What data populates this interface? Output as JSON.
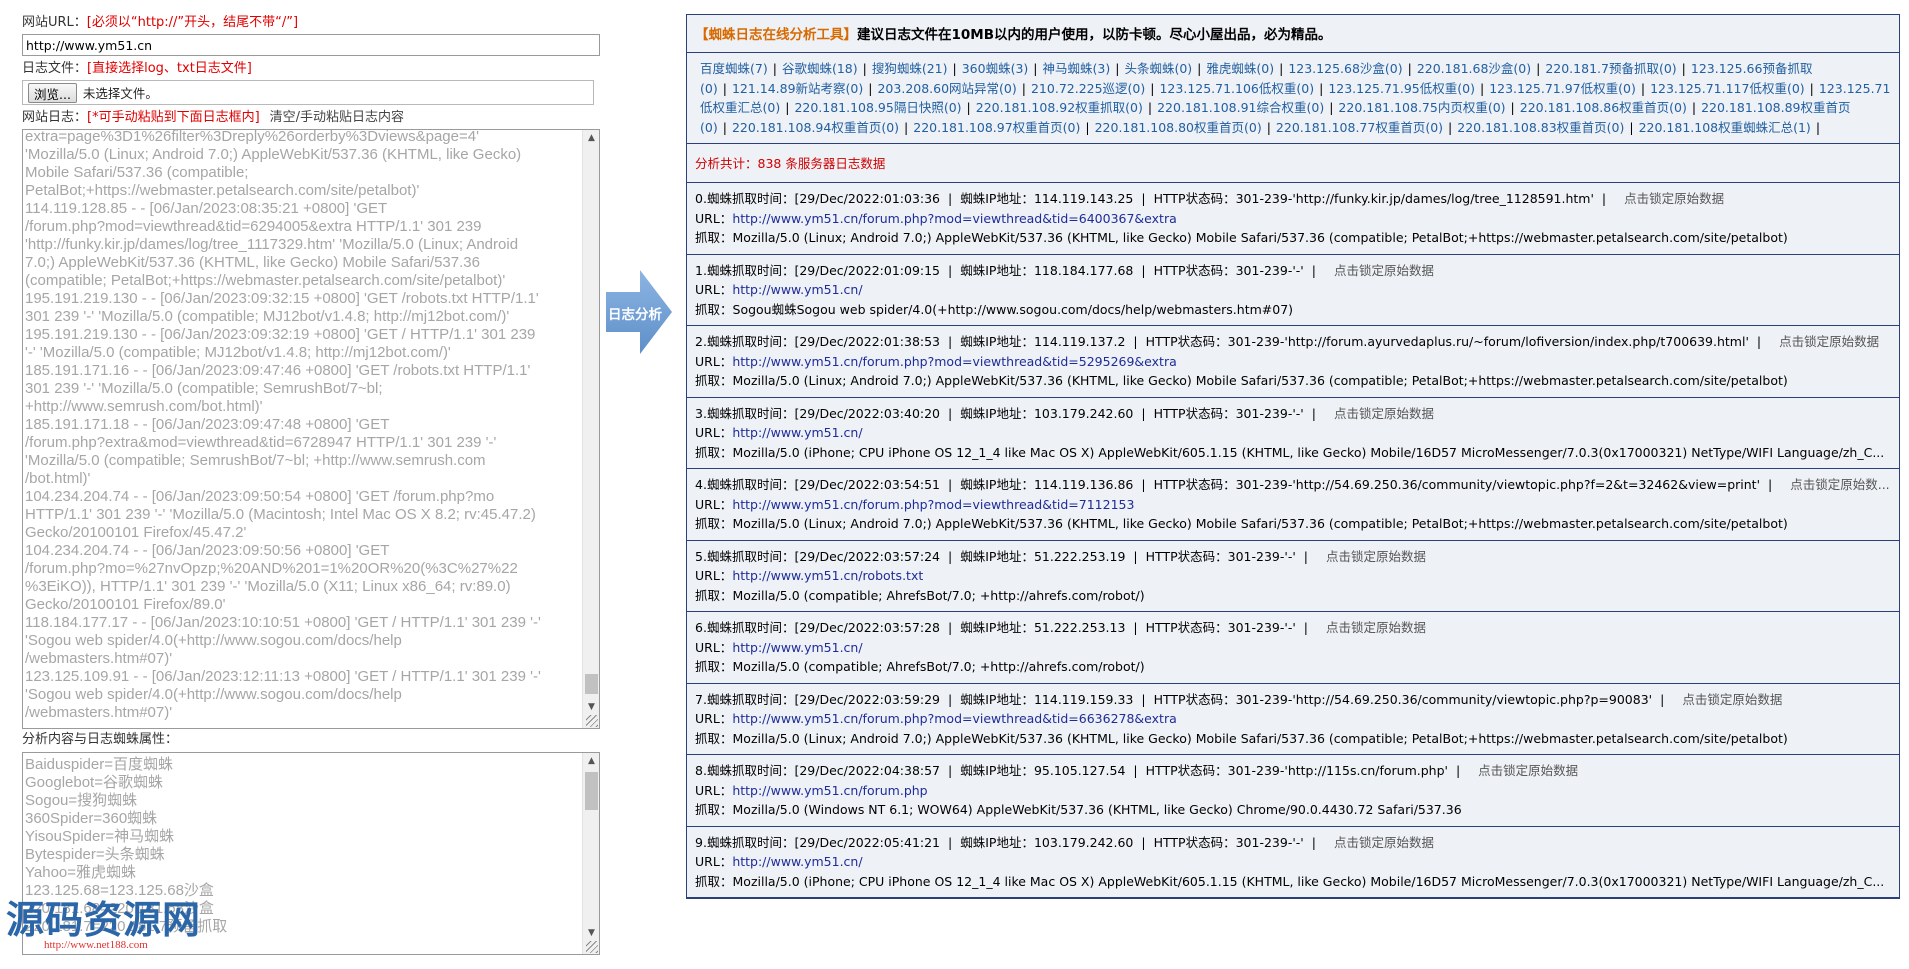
{
  "left": {
    "url_label": "网站URL：",
    "url_hint": "[必须以“http://”开头，结尾不带“/”]",
    "url_value": "http://www.ym51.cn",
    "file_label": "日志文件：",
    "file_hint": "[直接选择log、txt日志文件]",
    "browse_label": "浏览...",
    "file_status": "未选择文件。",
    "log_label": "网站日志：",
    "log_hint": "[*可手动粘贴到下面日志框内]",
    "log_clear": "清空/手动粘贴日志内容",
    "log_text": "extra=page%3D1%26filter%3Dreply%26orderby%3Dviews&page=4'\n'Mozilla/5.0 (Linux; Android 7.0;) AppleWebKit/537.36 (KHTML, like Gecko)\nMobile Safari/537.36 (compatible;\nPetalBot;+https://webmaster.petalsearch.com/site/petalbot)'\n114.119.128.85 - - [06/Jan/2023:08:35:21 +0800] 'GET\n/forum.php?mod=viewthread&tid=6294005&extra HTTP/1.1' 301 239\n'http://funky.kir.jp/dames/log/tree_1117329.htm' 'Mozilla/5.0 (Linux; Android\n7.0;) AppleWebKit/537.36 (KHTML, like Gecko) Mobile Safari/537.36\n(compatible; PetalBot;+https://webmaster.petalsearch.com/site/petalbot)'\n195.191.219.130 - - [06/Jan/2023:09:32:15 +0800] 'GET /robots.txt HTTP/1.1'\n301 239 '-' 'Mozilla/5.0 (compatible; MJ12bot/v1.4.8; http://mj12bot.com/)'\n195.191.219.130 - - [06/Jan/2023:09:32:19 +0800] 'GET / HTTP/1.1' 301 239\n'-' 'Mozilla/5.0 (compatible; MJ12bot/v1.4.8; http://mj12bot.com/)'\n185.191.171.16 - - [06/Jan/2023:09:47:46 +0800] 'GET /robots.txt HTTP/1.1'\n301 239 '-' 'Mozilla/5.0 (compatible; SemrushBot/7~bl;\n+http://www.semrush.com/bot.html)'\n185.191.171.18 - - [06/Jan/2023:09:47:48 +0800] 'GET\n/forum.php?extra&mod=viewthread&tid=6728947 HTTP/1.1' 301 239 '-'\n'Mozilla/5.0 (compatible; SemrushBot/7~bl; +http://www.semrush.com\n/bot.html)'\n104.234.204.74 - - [06/Jan/2023:09:50:54 +0800] 'GET /forum.php?mo\nHTTP/1.1' 301 239 '-' 'Mozilla/5.0 (Macintosh; Intel Mac OS X 8.2; rv:45.47.2)\nGecko/20100101 Firefox/45.47.2'\n104.234.204.74 - - [06/Jan/2023:09:50:56 +0800] 'GET\n/forum.php?mo=%27nvOpzp;%20AND%201=1%20OR%20(%3C%27%22\n%3EiKO)), HTTP/1.1' 301 239 '-' 'Mozilla/5.0 (X11; Linux x86_64; rv:89.0)\nGecko/20100101 Firefox/89.0'\n118.184.177.17 - - [06/Jan/2023:10:10:51 +0800] 'GET / HTTP/1.1' 301 239 '-'\n'Sogou web spider/4.0(+http://www.sogou.com/docs/help\n/webmasters.htm#07)'\n123.125.109.91 - - [06/Jan/2023:12:11:13 +0800] 'GET / HTTP/1.1' 301 239 '-'\n'Sogou web spider/4.0(+http://www.sogou.com/docs/help\n/webmasters.htm#07)'",
    "attr_label": "分析内容与日志蜘蛛属性：",
    "attr_text": "Baiduspider=百度蜘蛛\nGooglebot=谷歌蜘蛛\nSogou=搜狗蜘蛛\n360Spider=360蜘蛛\nYisouSpider=神马蜘蛛\nBytespider=头条蜘蛛\nYahoo=雅虎蜘蛛\n123.125.68=123.125.68沙盒\n220.181.68=220.181.68沙盒\n220.181.7=220.181.7预备抓取",
    "watermark": "源码资源网",
    "watermark_url": "http://www.net188.com"
  },
  "arrow_label": "日志分析",
  "right": {
    "title_org": "【蜘蛛日志在线分析工具】",
    "title_rest": "建议日志文件在10MB以内的用户使用，以防卡顿。尽心小屋出品，必为精品。",
    "spiders": [
      "百度蜘蛛(7)",
      "谷歌蜘蛛(18)",
      "搜狗蜘蛛(21)",
      "360蜘蛛(3)",
      "神马蜘蛛(3)",
      "头条蜘蛛(0)",
      "雅虎蜘蛛(0)",
      "123.125.68沙盒(0)",
      "220.181.68沙盒(0)",
      "220.181.7预备抓取(0)",
      "123.125.66预备抓取(0)",
      "121.14.89新站考察(0)",
      "203.208.60网站异常(0)",
      "210.72.225巡逻(0)",
      "123.125.71.106低权重(0)",
      "123.125.71.95低权重(0)",
      "123.125.71.97低权重(0)",
      "123.125.71.117低权重(0)",
      "123.125.71低权重汇总(0)",
      "220.181.108.95隔日快照(0)",
      "220.181.108.92权重抓取(0)",
      "220.181.108.91综合权重(0)",
      "220.181.108.75内页权重(0)",
      "220.181.108.86权重首页(0)",
      "220.181.108.89权重首页(0)",
      "220.181.108.94权重首页(0)",
      "220.181.108.97权重首页(0)",
      "220.181.108.80权重首页(0)",
      "220.181.108.77权重首页(0)",
      "220.181.108.83权重首页(0)",
      "220.181.108权重蜘蛛汇总(1)"
    ],
    "total": "分析共计：838 条服务器日志数据",
    "labels": {
      "time": "蜘蛛抓取时间：",
      "ip": "蜘蛛IP地址：",
      "status": "HTTP状态码：",
      "lock": "点击锁定原始数据",
      "url": "URL：",
      "agent": "抓取："
    },
    "entries": [
      {
        "idx": "0.",
        "time": "[29/Dec/2022:01:03:36",
        "ip": "114.119.143.25",
        "status": "301-239-'http://funky.kir.jp/dames/log/tree_1128591.htm'",
        "lock": "点击锁定原始数据",
        "url": "http://www.ym51.cn/forum.php?mod=viewthread&tid=6400367&extra",
        "agent": "Mozilla/5.0 (Linux; Android 7.0;) AppleWebKit/537.36 (KHTML, like Gecko) Mobile Safari/537.36 (compatible; PetalBot;+https://webmaster.petalsearch.com/site/petalbot)"
      },
      {
        "idx": "1.",
        "time": "[29/Dec/2022:01:09:15",
        "ip": "118.184.177.68",
        "status": "301-239-'-'",
        "lock": "点击锁定原始数据",
        "url": "http://www.ym51.cn/",
        "agent": "Sogou蜘蛛Sogou web spider/4.0(+http://www.sogou.com/docs/help/webmasters.htm#07)"
      },
      {
        "idx": "2.",
        "time": "[29/Dec/2022:01:38:53",
        "ip": "114.119.137.2",
        "status": "301-239-'http://forum.ayurvedaplus.ru/~forum/lofiversion/index.php/t700639.html'",
        "lock": "点击锁定原始数据",
        "url": "http://www.ym51.cn/forum.php?mod=viewthread&tid=5295269&extra",
        "agent": "Mozilla/5.0 (Linux; Android 7.0;) AppleWebKit/537.36 (KHTML, like Gecko) Mobile Safari/537.36 (compatible; PetalBot;+https://webmaster.petalsearch.com/site/petalbot)"
      },
      {
        "idx": "3.",
        "time": "[29/Dec/2022:03:40:20",
        "ip": "103.179.242.60",
        "status": "301-239-'-'",
        "lock": "点击锁定原始数据",
        "url": "http://www.ym51.cn/",
        "agent": "Mozilla/5.0 (iPhone; CPU iPhone OS 12_1_4 like Mac OS X) AppleWebKit/605.1.15 (KHTML, like Gecko) Mobile/16D57 MicroMessenger/7.0.3(0x17000321) NetType/WIFI Language/zh_C..."
      },
      {
        "idx": "4.",
        "time": "[29/Dec/2022:03:54:51",
        "ip": "114.119.136.86",
        "status": "301-239-'http://54.69.250.36/community/viewtopic.php?f=2&t=32462&view=print'",
        "lock": "点击锁定原始数...",
        "url": "http://www.ym51.cn/forum.php?mod=viewthread&tid=7112153",
        "agent": "Mozilla/5.0 (Linux; Android 7.0;) AppleWebKit/537.36 (KHTML, like Gecko) Mobile Safari/537.36 (compatible; PetalBot;+https://webmaster.petalsearch.com/site/petalbot)"
      },
      {
        "idx": "5.",
        "time": "[29/Dec/2022:03:57:24",
        "ip": "51.222.253.19",
        "status": "301-239-'-'",
        "lock": "点击锁定原始数据",
        "url": "http://www.ym51.cn/robots.txt",
        "agent": "Mozilla/5.0 (compatible; AhrefsBot/7.0; +http://ahrefs.com/robot/)"
      },
      {
        "idx": "6.",
        "time": "[29/Dec/2022:03:57:28",
        "ip": "51.222.253.13",
        "status": "301-239-'-'",
        "lock": "点击锁定原始数据",
        "url": "http://www.ym51.cn/",
        "agent": "Mozilla/5.0 (compatible; AhrefsBot/7.0; +http://ahrefs.com/robot/)"
      },
      {
        "idx": "7.",
        "time": "[29/Dec/2022:03:59:29",
        "ip": "114.119.159.33",
        "status": "301-239-'http://54.69.250.36/community/viewtopic.php?p=90083'",
        "lock": "点击锁定原始数据",
        "url": "http://www.ym51.cn/forum.php?mod=viewthread&tid=6636278&extra",
        "agent": "Mozilla/5.0 (Linux; Android 7.0;) AppleWebKit/537.36 (KHTML, like Gecko) Mobile Safari/537.36 (compatible; PetalBot;+https://webmaster.petalsearch.com/site/petalbot)"
      },
      {
        "idx": "8.",
        "time": "[29/Dec/2022:04:38:57",
        "ip": "95.105.127.54",
        "status": "301-239-'http://115s.cn/forum.php'",
        "lock": "点击锁定原始数据",
        "url": "http://www.ym51.cn/forum.php",
        "agent": "Mozilla/5.0 (Windows NT 6.1; WOW64) AppleWebKit/537.36 (KHTML, like Gecko) Chrome/90.0.4430.72 Safari/537.36"
      },
      {
        "idx": "9.",
        "time": "[29/Dec/2022:05:41:21",
        "ip": "103.179.242.60",
        "status": "301-239-'-'",
        "lock": "点击锁定原始数据",
        "url": "http://www.ym51.cn/",
        "agent": "Mozilla/5.0 (iPhone; CPU iPhone OS 12_1_4 like Mac OS X) AppleWebKit/605.1.15 (KHTML, like Gecko) Mobile/16D57 MicroMessenger/7.0.3(0x17000321) NetType/WIFI Language/zh_C..."
      }
    ]
  },
  "colors": {
    "accent_red": "#e00000",
    "title_orange": "#d76a00",
    "link_blue": "#225fa0",
    "url_blue": "#1e2c98",
    "panel_bg": "#eef1f6",
    "border": "#2b3f7a",
    "arrow": "#6f9fd4"
  },
  "icons": {
    "arrow": "right-arrow-icon",
    "scroll_up": "chevron-up-icon",
    "scroll_down": "chevron-down-icon"
  }
}
